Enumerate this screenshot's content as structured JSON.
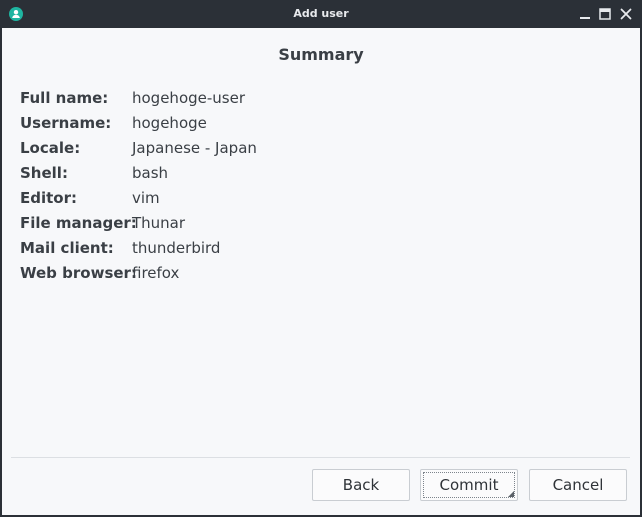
{
  "window": {
    "title": "Add user",
    "app_icon": "user-icon",
    "controls": {
      "minimize": "minimize-icon",
      "maximize": "maximize-icon",
      "close": "close-icon"
    }
  },
  "summary": {
    "heading": "Summary",
    "fields": [
      {
        "label": "Full name:",
        "value": "hogehoge-user"
      },
      {
        "label": "Username:",
        "value": "hogehoge"
      },
      {
        "label": "Locale:",
        "value": "Japanese - Japan"
      },
      {
        "label": "Shell:",
        "value": "bash"
      },
      {
        "label": "Editor:",
        "value": "vim"
      },
      {
        "label": "File manager:",
        "value": "Thunar"
      },
      {
        "label": "Mail client:",
        "value": "thunderbird"
      },
      {
        "label": "Web browser:",
        "value": "firefox"
      }
    ]
  },
  "buttons": {
    "back": "Back",
    "commit": "Commit",
    "cancel": "Cancel"
  },
  "colors": {
    "titlebar": "#2b3037",
    "content_bg": "#f7f8fa",
    "accent": "#1fb5a1"
  }
}
